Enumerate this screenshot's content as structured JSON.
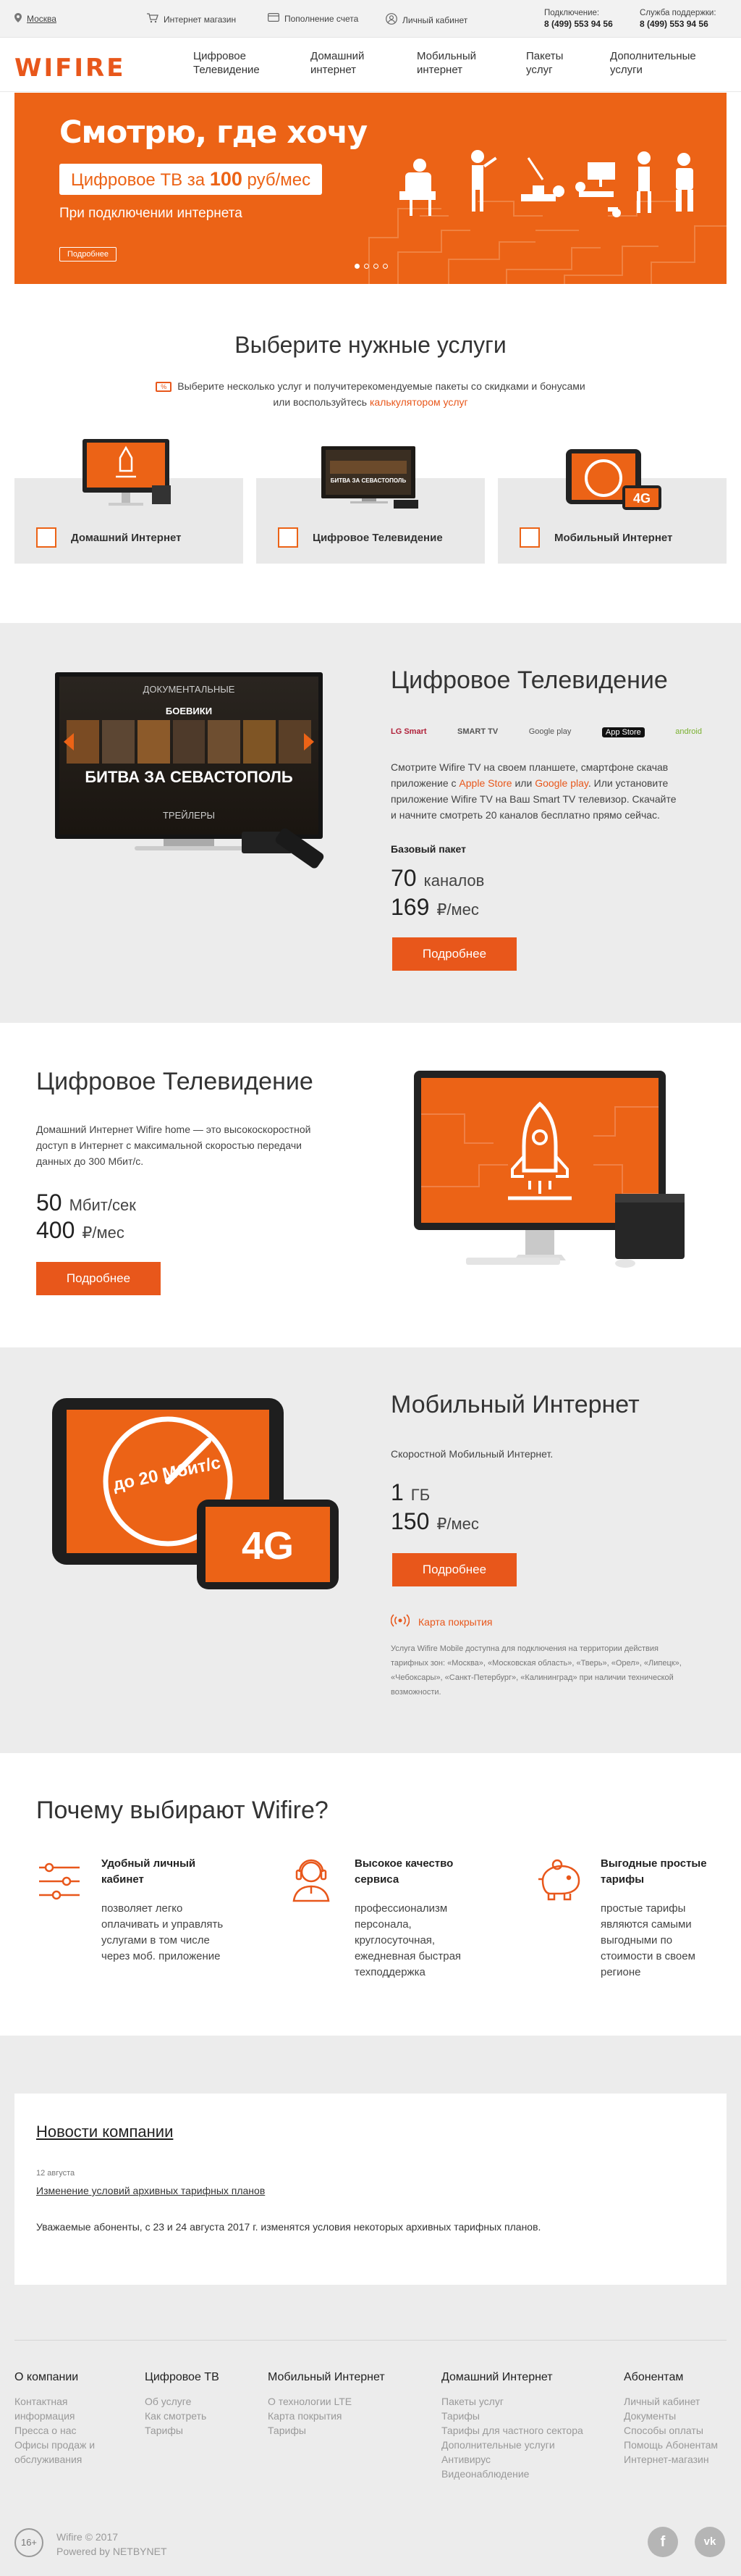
{
  "topbar": {
    "city": "Москва",
    "shop": "Интернет магазин",
    "topup": "Пополнение счета",
    "cabinet": "Личный кабинет",
    "connect_label": "Подключение:",
    "connect_phone": "8 (499) 553 94 56",
    "support_label": "Служба поддержки:",
    "support_phone": "8 (499) 553 94 56"
  },
  "nav": {
    "logo": "WIFIRE",
    "items": [
      {
        "l1": "Цифровое",
        "l2": "Телевидение"
      },
      {
        "l1": "Домашний",
        "l2": "интернет"
      },
      {
        "l1": "Мобильный",
        "l2": "интернет"
      },
      {
        "l1": "Пакеты",
        "l2": "услуг"
      },
      {
        "l1": "Дополнительные",
        "l2": "услуги"
      }
    ]
  },
  "hero": {
    "title": "Смотрю, где хочу",
    "pill_text": "Цифровое ТВ за ",
    "pill_price": "100",
    "pill_unit": " руб/мес",
    "subtitle": "При подключении интернета",
    "more": "Подробнее",
    "slides_total": 4,
    "slide_active": 1
  },
  "services": {
    "title": "Выберите нужные услуги",
    "desc_l1": "Выберите несколько услуг и получитерекомендуемые пакеты со скидками и бонусами",
    "desc_l2": "или воспользуйтесь ",
    "desc_link": "калькулятором услуг",
    "cards": [
      "Домашний Интернет",
      "Цифровое Телевидение",
      "Мобильный Интернет"
    ]
  },
  "tv_screen": {
    "docs": "ДОКУМЕНТАЛЬНЫЕ",
    "action": "БОЕВИКИ",
    "movie": "БИТВА ЗА СЕВАСТОПОЛЬ",
    "trailers": "ТРЕЙЛЕРЫ",
    "card_movie": "БИТВА ЗА СЕВАСТОПОЛЬ"
  },
  "tv": {
    "title": "Цифровое Телевидение",
    "platforms": [
      "LG Smart",
      "SMART TV",
      "Google play",
      "App Store",
      "android"
    ],
    "p1": "Смотрите Wifire TV на своем планшете, смартфоне скачав",
    "p2a": "приложение с ",
    "p2_link1": "Apple Store",
    "p2b": "  или ",
    "p2_link2": "Google play",
    "p2c": ". Или установите",
    "p3": "приложение Wifire TV на Ваш Smart TV телевизор. Скачайте",
    "p4": "и начните смотреть 20 каналов бесплатно прямо сейчас.",
    "package": "Базовый пакет",
    "channels": "70",
    "channels_unit": "каналов",
    "price": "169",
    "price_unit": "₽/мес",
    "button": "Подробнее"
  },
  "inet": {
    "title": "Цифровое Телевидение",
    "p1": "Домашний Интернет Wifire home — это высокоскоростной",
    "p2": "доступ в Интернет с максимальной скоростью передачи",
    "p3": "данных до 300 Мбит/с.",
    "speed": "50",
    "speed_unit": "Мбит/сек",
    "price": "400",
    "price_unit": "₽/мес",
    "button": "Подробнее"
  },
  "mobile": {
    "title": "Мобильный Интернет",
    "desc": "Скоростной Мобильный Интернет.",
    "gb": "1",
    "gb_unit": "ГБ",
    "price": "150",
    "price_unit": "₽/мес",
    "button": "Подробнее",
    "coverage": "Карта покрытия",
    "speed_badge": "до 20 Мбит/с",
    "lte": "4G",
    "note": [
      "Услуга Wifire Mobile доступна для подключения на территории действия",
      "тарифных зон: «Москва», «Московская область», «Тверь», «Орел», «Липецк»,",
      "«Чебоксары», «Санкт-Петербург», «Калининград» при наличии технической",
      "возможности."
    ]
  },
  "why": {
    "title": "Почему выбирают Wifire?",
    "items": [
      {
        "t1": "Удобный личный",
        "t2": "кабинет",
        "p": [
          "позволяет легко",
          "оплачивать и управлять",
          "услугами в том числе",
          "через моб. приложение"
        ]
      },
      {
        "t1": "Высокое качество",
        "t2": "сервиса",
        "p": [
          "профессионализм",
          "персонала,",
          "круглосуточная,",
          "ежедневная быстрая",
          "техподдержка"
        ]
      },
      {
        "t1": "Выгодные простые",
        "t2": "тарифы",
        "p": [
          "простые тарифы",
          "являются самыми",
          "выгодными по",
          "стоимости в своем",
          "регионе"
        ]
      }
    ]
  },
  "news": {
    "title": "Новости компании",
    "date": "12 августа",
    "link": "Изменение условий архивных тарифных планов",
    "text": "Уважаемые абоненты, с 23 и 24 августа 2017 г. изменятся условия некоторых архивных тарифных планов."
  },
  "footer": {
    "cols": [
      {
        "title": "О компании",
        "links": [
          "Контактная",
          "информация",
          "Пресса о нас",
          "Офисы продаж и",
          "обслуживания"
        ]
      },
      {
        "title": "Цифровое ТВ",
        "links": [
          "Об услуге",
          "Как смотреть",
          "Тарифы"
        ]
      },
      {
        "title": "Мобильный Интернет",
        "links": [
          "О технологии LTE",
          "Карта покрытия",
          "Тарифы"
        ]
      },
      {
        "title": "Домашний Интернет",
        "links": [
          "Пакеты услуг",
          "Тарифы",
          "Тарифы для частного сектора",
          "Дополнительные услуги",
          "Антивирус",
          "Видеонаблюдение"
        ]
      },
      {
        "title": "Абонентам",
        "links": [
          "Личный кабинет",
          "Документы",
          "Способы оплаты",
          "Помощь Абонентам",
          "Интернет-магазин"
        ]
      }
    ],
    "age": "16+",
    "copyright": "Wifire © 2017",
    "powered": "Powered by NETBYNET",
    "fb": "f",
    "vk": "vk"
  },
  "colors": {
    "accent": "#e8571b",
    "hero": "#ec6316",
    "band_gray": "#ececec"
  }
}
